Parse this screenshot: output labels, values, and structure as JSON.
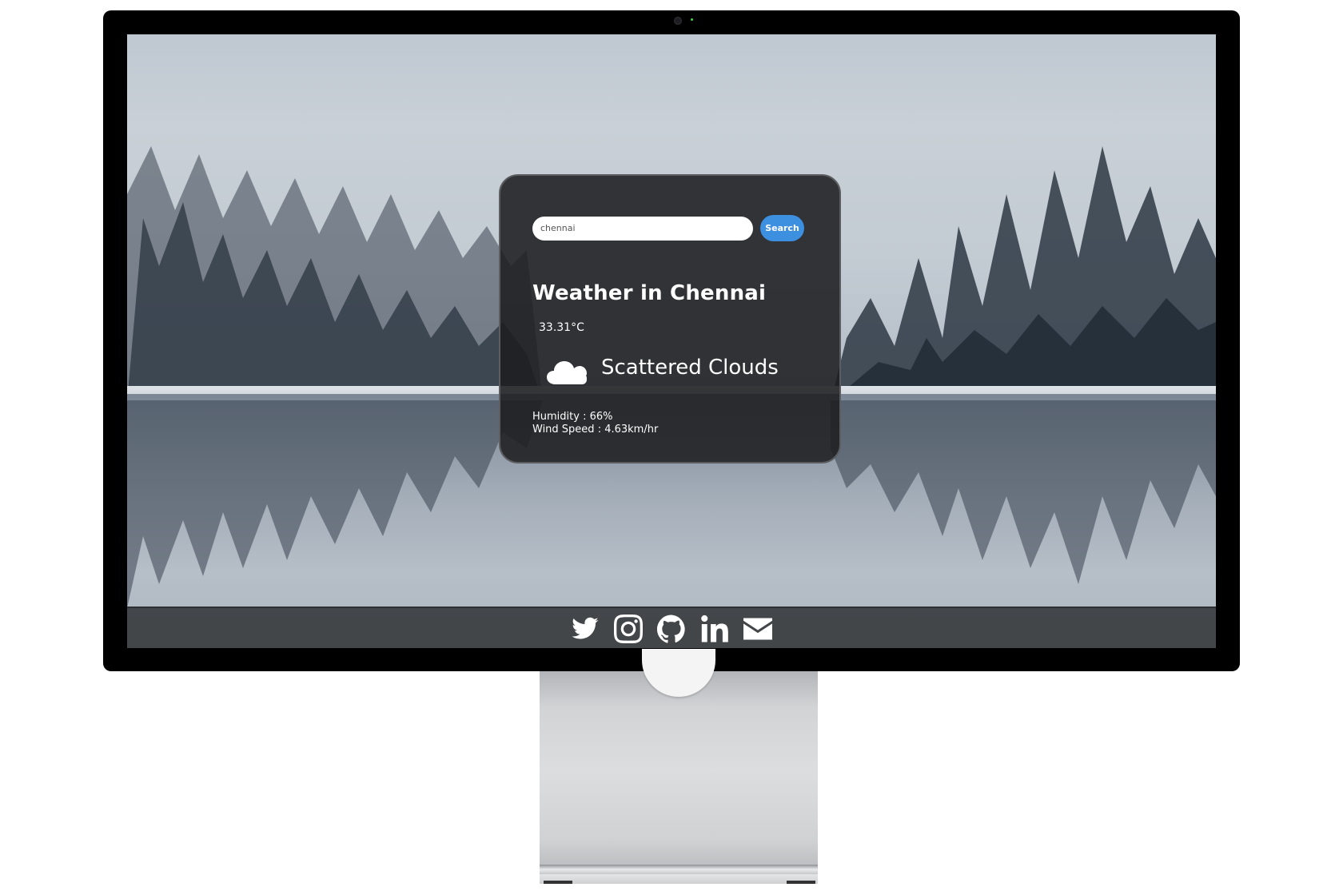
{
  "search": {
    "value": "chennai",
    "button_label": "Search"
  },
  "weather": {
    "title": "Weather in Chennai",
    "temperature": "33.31°C",
    "description": "Scattered Clouds",
    "icon": "cloud-icon",
    "humidity": "Humidity : 66%",
    "wind_speed": "Wind Speed : 4.63km/hr"
  },
  "footer": {
    "links": [
      {
        "icon": "twitter-icon"
      },
      {
        "icon": "instagram-icon"
      },
      {
        "icon": "github-icon"
      },
      {
        "icon": "linkedin-icon"
      },
      {
        "icon": "mail-icon"
      }
    ]
  },
  "colors": {
    "card_background": "#1e1e20",
    "search_button": "#3d8fe0",
    "footer_bar": "#3a3c3f",
    "text": "#ffffff"
  }
}
